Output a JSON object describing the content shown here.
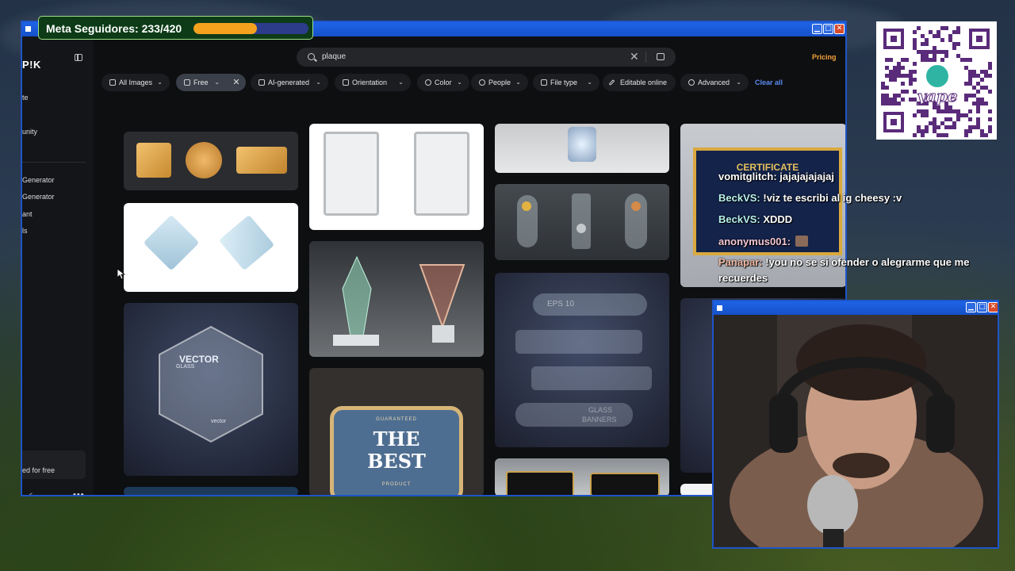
{
  "overlay": {
    "goal_label": "Meta Seguidores: 233/420",
    "goal_current": 233,
    "goal_target": 420,
    "qr_brand": "yape"
  },
  "browser": {
    "logo": "P!K",
    "sidebar": {
      "items": [
        "te",
        "unity",
        "Generator",
        "Generator",
        "ant",
        "ls"
      ],
      "promo": "ed for free"
    },
    "search": {
      "value": "plaque"
    },
    "pricing": "Pricing",
    "filters": [
      {
        "label": "All Images",
        "icon": "grid-icon"
      },
      {
        "label": "Free",
        "icon": "file-icon"
      },
      {
        "label": "AI-generated",
        "icon": "image-icon"
      },
      {
        "label": "Orientation",
        "icon": "orientation-icon"
      },
      {
        "label": "Color",
        "icon": "palette-icon"
      },
      {
        "label": "People",
        "icon": "people-icon"
      },
      {
        "label": "File type",
        "icon": "file-icon"
      },
      {
        "label": "Editable online",
        "icon": "pencil-icon"
      },
      {
        "label": "Advanced",
        "icon": "gear-icon"
      }
    ],
    "clear_all": "Clear all",
    "gallery": {
      "vector_glass_title": "VECTOR",
      "vector_glass_sub": "GLASS",
      "vector_logo": "vector",
      "best_top": "GUARANTEED",
      "best_line1": "THE",
      "best_line2": "BEST",
      "best_bottom": "PRODUCT",
      "eps_label": "EPS 10",
      "glass_banners": "GLASS",
      "glass_banners2": "BANNERS",
      "certificate_title": "CERTIFICATE"
    }
  },
  "chat": [
    {
      "user": "vomitglitch:",
      "text": " jajajajajajaj",
      "color": "#f4f4f4"
    },
    {
      "user": "BeckVS:",
      "text": " !viz te escribi al ig cheesy :v",
      "color": "#b7f0ec"
    },
    {
      "user": "BeckVS:",
      "text": " XDDD",
      "color": "#b7f0ec"
    },
    {
      "user": "anonymus001:",
      "text": "",
      "color": "#f2c7d3"
    },
    {
      "user": "Panapar:",
      "text": " !you no se si ofender o alegrarme que me",
      "color": "#f0b9a3"
    },
    {
      "user": "",
      "text": "recuerdes",
      "color": "#f4f4f4"
    }
  ]
}
